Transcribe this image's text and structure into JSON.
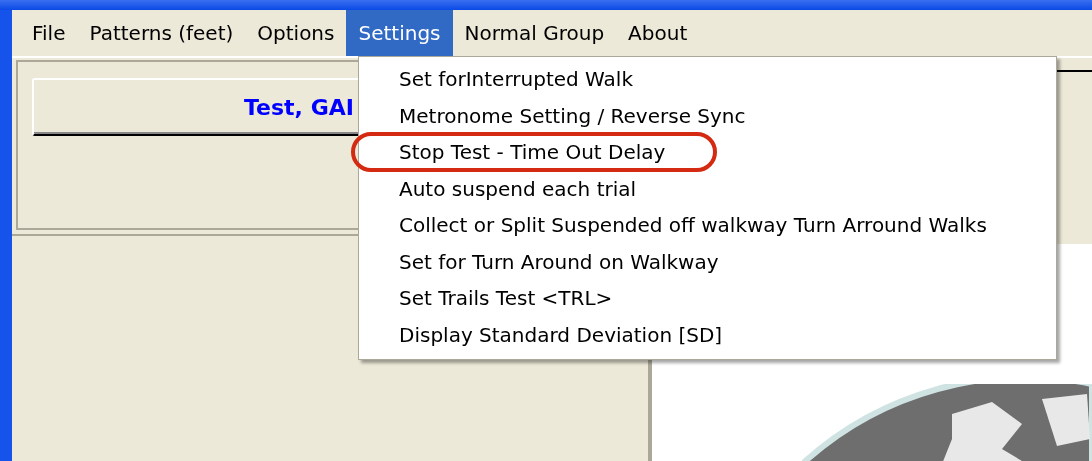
{
  "menu_bar": [
    {
      "label": "File",
      "selected": false
    },
    {
      "label": "Patterns (feet)",
      "selected": false
    },
    {
      "label": "Options",
      "selected": false
    },
    {
      "label": "Settings",
      "selected": true
    },
    {
      "label": "Normal Group",
      "selected": false
    },
    {
      "label": "About",
      "selected": false
    }
  ],
  "dropdown": {
    "items": [
      {
        "label": "Set forInterrupted Walk",
        "highlighted": false
      },
      {
        "label": "Metronome Setting / Reverse Sync",
        "highlighted": false
      },
      {
        "label": "Stop Test - Time Out Delay",
        "highlighted": true
      },
      {
        "label": "Auto suspend each trial",
        "highlighted": false
      },
      {
        "label": "Collect or Split Suspended off walkway Turn Arround Walks",
        "highlighted": false
      },
      {
        "label": "Set for Turn Around on Walkway",
        "highlighted": false
      },
      {
        "label": "Set Trails Test <TRL>",
        "highlighted": false
      },
      {
        "label": "Display Standard Deviation [SD]",
        "highlighted": false
      }
    ]
  },
  "test_button": {
    "label": "Test, GAI"
  }
}
